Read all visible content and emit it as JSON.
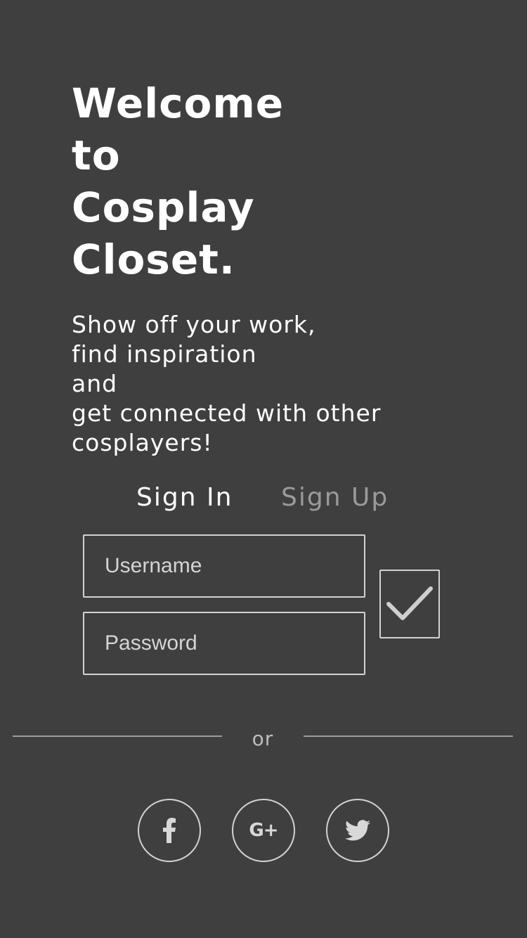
{
  "welcome": {
    "title_lines": [
      "Welcome",
      "to",
      "Cosplay",
      "Closet."
    ],
    "tagline_lines": [
      "Show off your work,",
      "find inspiration",
      "and",
      "get connected with other",
      "cosplayers!"
    ]
  },
  "auth_tabs": {
    "sign_in_label": "Sign In",
    "sign_up_label": "Sign Up",
    "active": "Sign In"
  },
  "form": {
    "username_placeholder": "Username",
    "username_value": "",
    "password_placeholder": "Password",
    "password_value": "",
    "submit_icon": "checkmark-icon"
  },
  "separator": {
    "or_label": "or"
  },
  "social_buttons": [
    {
      "icon": "facebook-icon",
      "glyph": "f"
    },
    {
      "icon": "google-plus-icon",
      "glyph": "G+"
    },
    {
      "icon": "twitter-icon",
      "glyph": ""
    }
  ],
  "colors": {
    "background": "#3f3f3f",
    "text_primary": "#ffffff",
    "text_muted": "#9a9a9a",
    "border": "#d2d2d2",
    "divider": "#9c9c9c"
  }
}
